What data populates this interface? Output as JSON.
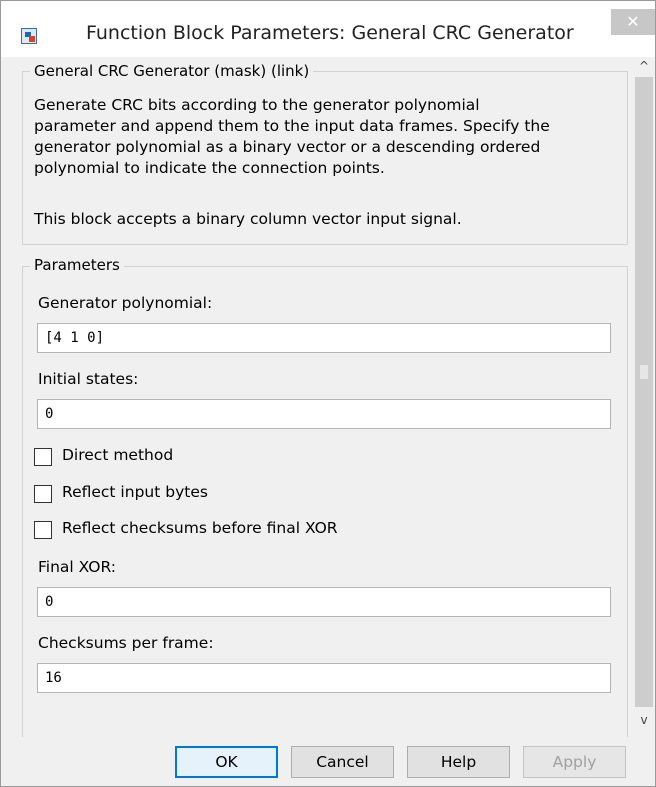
{
  "window": {
    "title": "Function Block Parameters: General CRC Generator",
    "close_symbol": "✕"
  },
  "description": {
    "legend": "General CRC Generator (mask) (link)",
    "lines": [
      "Generate CRC bits according to the generator polynomial",
      "parameter and append them to the input data frames. Specify the",
      "generator polynomial as a binary vector or a descending ordered",
      "polynomial to indicate the connection points."
    ],
    "note": "This block accepts a binary column vector input signal."
  },
  "parameters": {
    "legend": "Parameters",
    "generator_polynomial": {
      "label": "Generator polynomial:",
      "value": "[4 1 0]"
    },
    "initial_states": {
      "label": "Initial states:",
      "value": "0"
    },
    "direct_method": {
      "label": "Direct method",
      "checked": false
    },
    "reflect_input_bytes": {
      "label": "Reflect input bytes",
      "checked": false
    },
    "reflect_checksums": {
      "label": "Reflect checksums before final XOR",
      "checked": false
    },
    "final_xor": {
      "label": "Final XOR:",
      "value": "0"
    },
    "checksums_per_frame": {
      "label": "Checksums per frame:",
      "value": "16"
    }
  },
  "buttons": {
    "ok": "OK",
    "cancel": "Cancel",
    "help": "Help",
    "apply": "Apply"
  },
  "scrollbar": {
    "up_symbol": "^",
    "down_symbol": "v"
  },
  "colors": {
    "window_bg": "#f0f0f0",
    "default_button_border": "#0078d7"
  }
}
